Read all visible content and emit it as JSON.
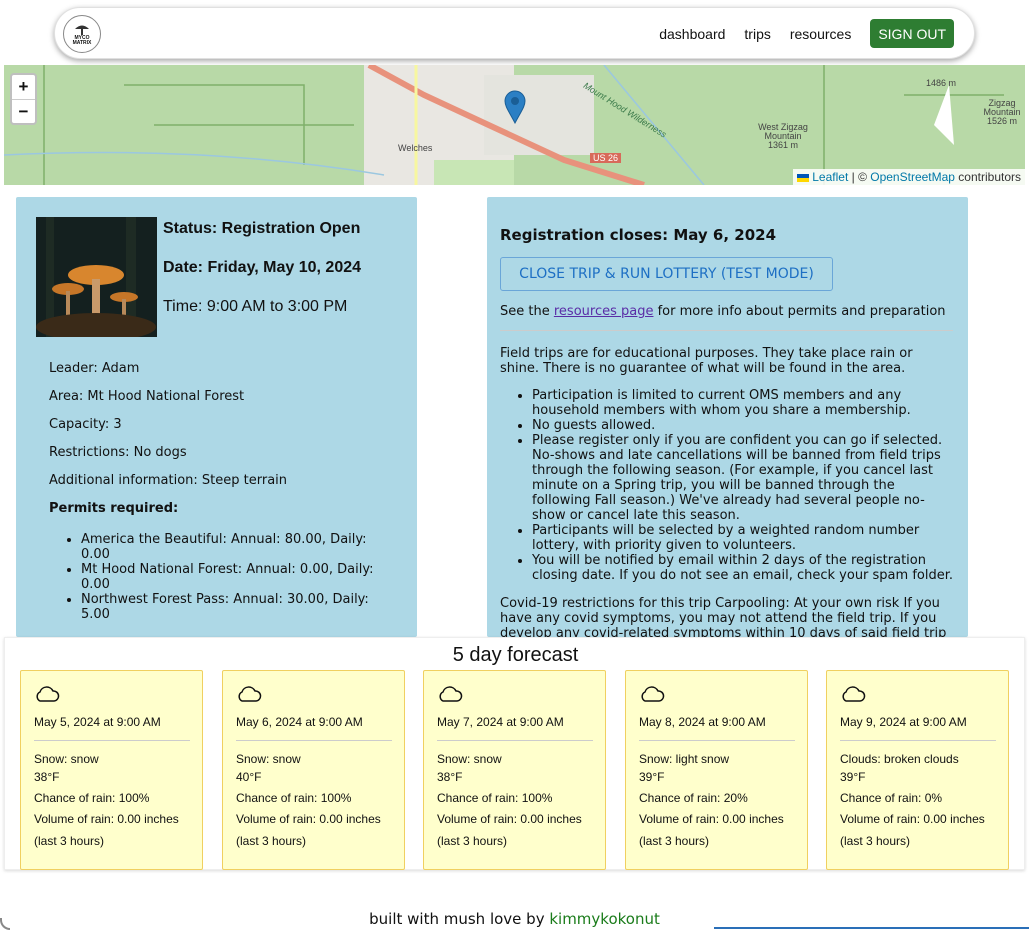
{
  "nav": {
    "logo_text_line1": "MYCO",
    "logo_text_line2": "MATRIX",
    "links": [
      "dashboard",
      "trips",
      "resources"
    ],
    "signout_label": "SIGN OUT"
  },
  "map": {
    "zoom_in": "+",
    "zoom_out": "−",
    "labels": {
      "welches": "Welches",
      "wilderness": "Mount Hood Wilderness",
      "us26": "US 26",
      "west_zigzag": "West Zigzag Mountain 1361 m",
      "zigzag": "Zigzag Mountain 1526 m",
      "elev": "1486 m"
    },
    "attribution": {
      "leaflet": "Leaflet",
      "sep": " | © ",
      "osm": "OpenStreetMap",
      "contributors": " contributors"
    }
  },
  "trip": {
    "status": "Status: Registration Open",
    "date": "Date: Friday, May 10, 2024",
    "time": "Time: 9:00 AM to 3:00 PM",
    "leader": "Leader: Adam",
    "area": "Area: Mt Hood National Forest",
    "capacity": "Capacity: 3",
    "restrictions": "Restrictions: No dogs",
    "additional": "Additional information: Steep terrain",
    "permits_title": "Permits required:",
    "permits": [
      "America the Beautiful: Annual: 80.00, Daily: 0.00",
      "Mt Hood National Forest: Annual: 0.00, Daily: 0.00",
      "Northwest Forest Pass: Annual: 30.00, Daily: 5.00"
    ]
  },
  "registration": {
    "closes": "Registration closes: May 6, 2024",
    "lottery_button": "CLOSE TRIP & RUN LOTTERY (TEST MODE)",
    "see_prefix": "See the ",
    "resources_link": "resources page",
    "see_suffix": " for more info about permits and preparation",
    "intro": "Field trips are for educational purposes. They take place rain or shine. There is no guarantee of what will be found in the area.",
    "rules": [
      "Participation is limited to current OMS members and any household members with whom you share a membership.",
      "No guests allowed.",
      "Please register only if you are confident you can go if selected. No-shows and late cancellations will be banned from field trips through the following season. (For example, if you cancel last minute on a Spring trip, you will be banned through the following Fall season.) We've already had several people no-show or cancel late this season.",
      "Participants will be selected by a weighted random number lottery, with priority given to volunteers.",
      "You will be notified by email within 2 days of the registration closing date. If you do not see an email, check your spam folder."
    ],
    "covid": "Covid-19 restrictions for this trip Carpooling: At your own risk If you have any covid symptoms, you may not attend the field trip. If you develop any covid-related symptoms within 10 days of said field trip"
  },
  "forecast": {
    "title": "5 day forecast",
    "days": [
      {
        "date": "May 5, 2024 at 9:00 AM",
        "condition": "Snow: snow",
        "temp": "38°F",
        "chance": "Chance of rain: 100%",
        "volume": "Volume of rain: 0.00 inches",
        "period": "(last 3 hours)"
      },
      {
        "date": "May 6, 2024 at 9:00 AM",
        "condition": "Snow: snow",
        "temp": "40°F",
        "chance": "Chance of rain: 100%",
        "volume": "Volume of rain: 0.00 inches",
        "period": "(last 3 hours)"
      },
      {
        "date": "May 7, 2024 at 9:00 AM",
        "condition": "Snow: snow",
        "temp": "38°F",
        "chance": "Chance of rain: 100%",
        "volume": "Volume of rain: 0.00 inches",
        "period": "(last 3 hours)"
      },
      {
        "date": "May 8, 2024 at 9:00 AM",
        "condition": "Snow: light snow",
        "temp": "39°F",
        "chance": "Chance of rain: 20%",
        "volume": "Volume of rain: 0.00 inches",
        "period": "(last 3 hours)"
      },
      {
        "date": "May 9, 2024 at 9:00 AM",
        "condition": "Clouds: broken clouds",
        "temp": "39°F",
        "chance": "Chance of rain: 0%",
        "volume": "Volume of rain: 0.00 inches",
        "period": "(last 3 hours)"
      }
    ]
  },
  "footer": {
    "prefix": "built with mush love by ",
    "author": "kimmykokonut"
  },
  "colors": {
    "card_bg": "#add8e6",
    "forecast_card_bg": "#ffffcc",
    "signout_bg": "#2e7d32",
    "map_green": "#b8d9a7",
    "link_blue": "#1d6fc4"
  }
}
